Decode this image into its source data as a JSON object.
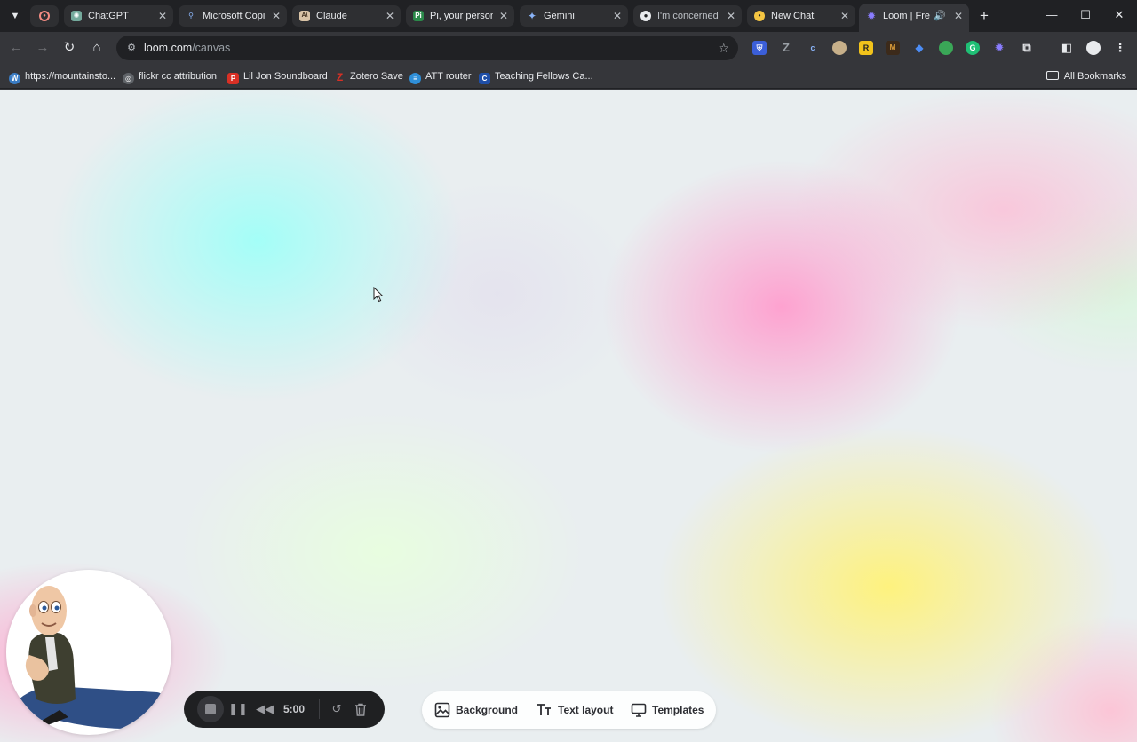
{
  "tabs": [
    {
      "label": "",
      "icon": "record-icon"
    },
    {
      "label": "ChatGPT",
      "icon": "chatgpt-icon"
    },
    {
      "label": "Microsoft Copi",
      "icon": "copilot-icon"
    },
    {
      "label": "Claude",
      "icon": "claude-icon"
    },
    {
      "label": "Pi, your person",
      "icon": "pi-icon"
    },
    {
      "label": "Gemini",
      "icon": "gemini-icon"
    },
    {
      "label": "I'm concerned",
      "icon": "github-icon"
    },
    {
      "label": "New Chat",
      "icon": "chat-icon"
    },
    {
      "label": "Loom | Free",
      "icon": "loom-icon",
      "active": true
    }
  ],
  "omnibox": {
    "host": "loom.com",
    "path": "/canvas"
  },
  "bookmarks": [
    {
      "label": "https://mountainsto...",
      "icon": "wordpress-icon"
    },
    {
      "label": "flickr cc attribution",
      "icon": "globe-icon"
    },
    {
      "label": "Lil Jon Soundboard",
      "icon": "p-icon"
    },
    {
      "label": "Zotero Save",
      "icon": "zotero-icon"
    },
    {
      "label": "ATT router",
      "icon": "att-icon"
    },
    {
      "label": "Teaching Fellows Ca...",
      "icon": "c-icon"
    }
  ],
  "bookmarks_all": "All Bookmarks",
  "recorder": {
    "timer": "5:00"
  },
  "canvas_toolbar": {
    "background": "Background",
    "text_layout": "Text layout",
    "templates": "Templates"
  }
}
